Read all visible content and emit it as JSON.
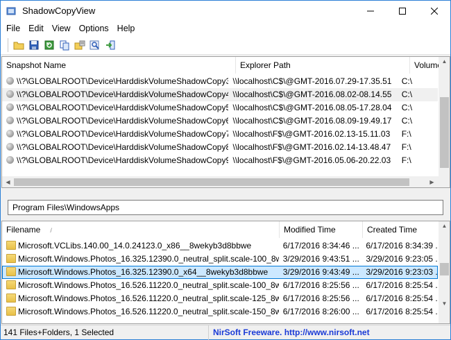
{
  "window": {
    "title": "ShadowCopyView"
  },
  "menu": [
    "File",
    "Edit",
    "View",
    "Options",
    "Help"
  ],
  "toolbar": [
    "open-icon",
    "save-icon",
    "refresh-icon",
    "copy-icon",
    "properties-icon",
    "find-icon",
    "exit-icon"
  ],
  "snapshots": {
    "columns": [
      "Snapshot Name",
      "Explorer Path",
      "Volume"
    ],
    "sort_arrow": "/",
    "rows": [
      [
        "\\\\?\\GLOBALROOT\\Device\\HarddiskVolumeShadowCopy3",
        "\\\\localhost\\C$\\@GMT-2016.07.29-17.35.51",
        "C:\\"
      ],
      [
        "\\\\?\\GLOBALROOT\\Device\\HarddiskVolumeShadowCopy4",
        "\\\\localhost\\C$\\@GMT-2016.08.02-08.14.55",
        "C:\\"
      ],
      [
        "\\\\?\\GLOBALROOT\\Device\\HarddiskVolumeShadowCopy5",
        "\\\\localhost\\C$\\@GMT-2016.08.05-17.28.04",
        "C:\\"
      ],
      [
        "\\\\?\\GLOBALROOT\\Device\\HarddiskVolumeShadowCopy6",
        "\\\\localhost\\C$\\@GMT-2016.08.09-19.49.17",
        "C:\\"
      ],
      [
        "\\\\?\\GLOBALROOT\\Device\\HarddiskVolumeShadowCopy7",
        "\\\\localhost\\F$\\@GMT-2016.02.13-15.11.03",
        "F:\\"
      ],
      [
        "\\\\?\\GLOBALROOT\\Device\\HarddiskVolumeShadowCopy8",
        "\\\\localhost\\F$\\@GMT-2016.02.14-13.48.47",
        "F:\\"
      ],
      [
        "\\\\?\\GLOBALROOT\\Device\\HarddiskVolumeShadowCopy9",
        "\\\\localhost\\F$\\@GMT-2016.05.06-20.22.03",
        "F:\\"
      ]
    ],
    "selected_index": 1
  },
  "path": {
    "value": "Program Files\\WindowsApps"
  },
  "files": {
    "columns": [
      "Filename",
      "Modified Time",
      "Created Time"
    ],
    "sort_arrow": "/",
    "rows": [
      [
        "Microsoft.VCLibs.140.00_14.0.24123.0_x86__8wekyb3d8bbwe",
        "6/17/2016 8:34:46 ...",
        "6/17/2016 8:34:39 ..."
      ],
      [
        "Microsoft.Windows.Photos_16.325.12390.0_neutral_split.scale-100_8w...",
        "3/29/2016 9:43:51 ...",
        "3/29/2016 9:23:05 ..."
      ],
      [
        "Microsoft.Windows.Photos_16.325.12390.0_x64__8wekyb3d8bbwe",
        "3/29/2016 9:43:49 ...",
        "3/29/2016 9:23:03 ..."
      ],
      [
        "Microsoft.Windows.Photos_16.526.11220.0_neutral_split.scale-100_8w...",
        "6/17/2016 8:25:56 ...",
        "6/17/2016 8:25:54 ..."
      ],
      [
        "Microsoft.Windows.Photos_16.526.11220.0_neutral_split.scale-125_8w...",
        "6/17/2016 8:25:56 ...",
        "6/17/2016 8:25:54 ..."
      ],
      [
        "Microsoft.Windows.Photos_16.526.11220.0_neutral_split.scale-150_8w...",
        "6/17/2016 8:26:00 ...",
        "6/17/2016 8:25:54 ..."
      ]
    ],
    "selected_index": 2
  },
  "status": {
    "count": "141 Files+Folders, 1 Selected",
    "link": "NirSoft Freeware.  http://www.nirsoft.net"
  },
  "colors": {
    "selection": "#cce8ff",
    "selection_border": "#0078d7",
    "link": "#1a3ad6",
    "titlebar_border": "#2b7fd6"
  }
}
